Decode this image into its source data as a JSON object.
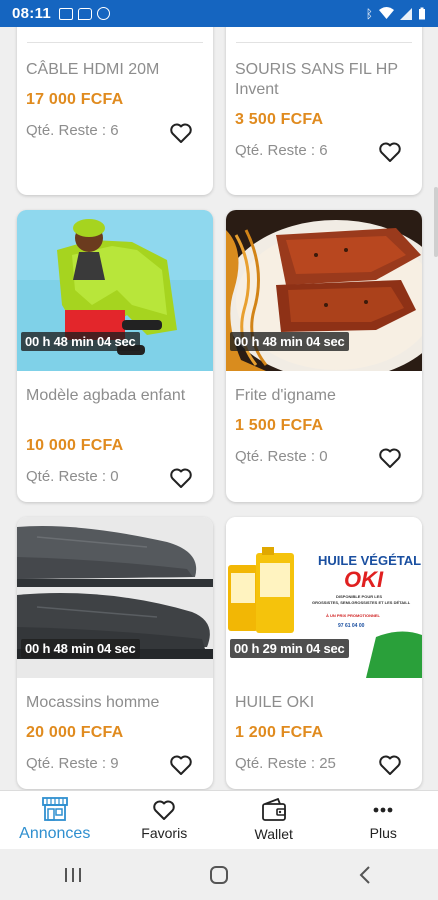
{
  "status_bar": {
    "time": "08:11",
    "left_icons": [
      "image-icon",
      "message-icon",
      "whatsapp-icon"
    ],
    "right_icons": [
      "bluetooth-icon",
      "wifi-icon",
      "signal-icon",
      "battery-icon"
    ]
  },
  "products": [
    {
      "name": "CÂBLE HDMI 20M",
      "price": "17 000 FCFA",
      "stock": "Qté. Reste : 6",
      "timer": ""
    },
    {
      "name": "SOURIS SANS FIL HP Invent",
      "price": "3 500 FCFA",
      "stock": "Qté. Reste : 6",
      "timer": ""
    },
    {
      "name": "Modèle agbada enfant",
      "price": "10 000 FCFA",
      "stock": "Qté. Reste : 0",
      "timer": "00 h 48 min 04 sec"
    },
    {
      "name": "Frite d'igname",
      "price": "1 500 FCFA",
      "stock": "Qté. Reste : 0",
      "timer": "00 h 48 min 04 sec"
    },
    {
      "name": "Mocassins homme",
      "price": "20 000 FCFA",
      "stock": "Qté. Reste : 9",
      "timer": "00 h 48 min 04 sec"
    },
    {
      "name": "HUILE OKI",
      "price": "1 200 FCFA",
      "stock": "Qté. Reste : 25",
      "timer": "00 h 29 min 04 sec"
    }
  ],
  "oki_ad": {
    "title": "HUILE VÉGÉTAL",
    "brand": "OKI",
    "line1": "DISPONIBLE POUR LES",
    "line2": "GROSSISTES, SEMI-GROSSISTES ET LES DÉTAILL",
    "line3": "À UN PRIX PROMOTIONNEL",
    "phone": "97 61 04 00"
  },
  "bottom_nav": [
    {
      "label": "Annonces",
      "icon": "store-icon",
      "active": true
    },
    {
      "label": "Favoris",
      "icon": "heart-icon",
      "active": false
    },
    {
      "label": "Wallet",
      "icon": "wallet-icon",
      "active": false
    },
    {
      "label": "Plus",
      "icon": "more-icon",
      "active": false
    }
  ],
  "colors": {
    "status_bar": "#1565c0",
    "price": "#e08b1f",
    "active_tab": "#2f8fcf",
    "muted_text": "#8d8d8d"
  }
}
